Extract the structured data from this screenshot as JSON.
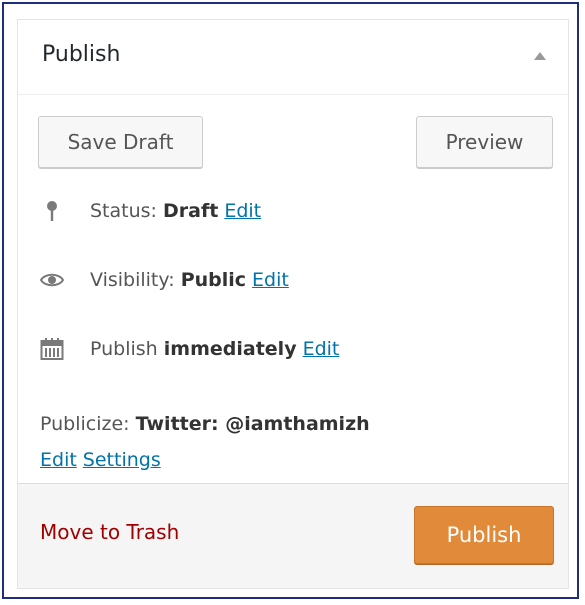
{
  "header": {
    "title": "Publish",
    "toggle_icon": "triangle-up-icon"
  },
  "actions": {
    "save_draft_label": "Save Draft",
    "preview_label": "Preview"
  },
  "status": {
    "icon": "pin-icon",
    "label": "Status:",
    "value": "Draft",
    "edit_label": "Edit"
  },
  "visibility": {
    "icon": "eye-icon",
    "label": "Visibility:",
    "value": "Public",
    "edit_label": "Edit"
  },
  "schedule": {
    "icon": "calendar-icon",
    "label": "Publish",
    "value": "immediately",
    "edit_label": "Edit"
  },
  "publicize": {
    "label": "Publicize:",
    "value": "Twitter: @iamthamizh",
    "edit_label": "Edit",
    "settings_label": "Settings"
  },
  "footer": {
    "trash_label": "Move to Trash",
    "publish_label": "Publish"
  },
  "colors": {
    "link": "#0073aa",
    "trash": "#a00000",
    "publish_button": "#e08a3a",
    "frame_border": "#1f2e7a"
  }
}
